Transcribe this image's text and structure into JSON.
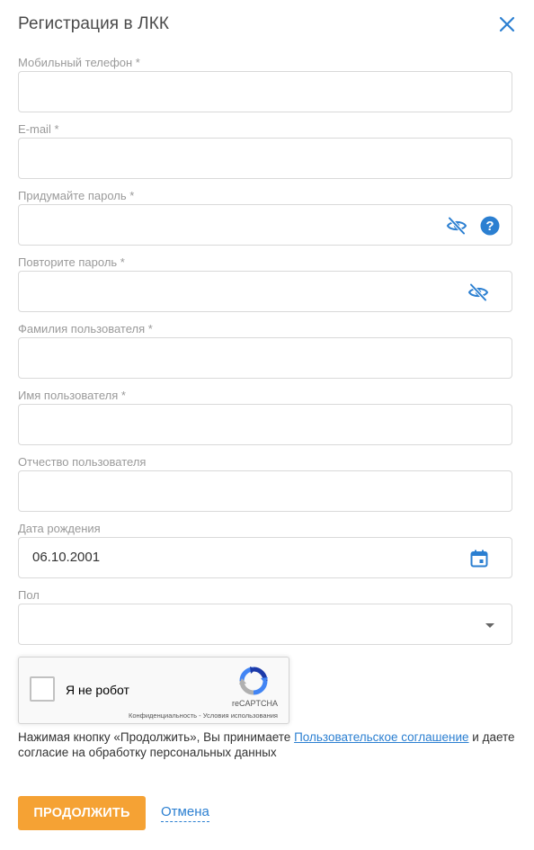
{
  "dialog": {
    "title": "Регистрация в ЛКК",
    "close_icon": "close-icon"
  },
  "fields": {
    "phone": {
      "label": "Мобильный телефон *",
      "value": ""
    },
    "email": {
      "label": "E-mail *",
      "value": ""
    },
    "password": {
      "label": "Придумайте пароль *",
      "value": ""
    },
    "password_repeat": {
      "label": "Повторите пароль *",
      "value": ""
    },
    "last_name": {
      "label": "Фамилия пользователя *",
      "value": ""
    },
    "first_name": {
      "label": "Имя пользователя *",
      "value": ""
    },
    "middle_name": {
      "label": "Отчество пользователя",
      "value": ""
    },
    "birth_date": {
      "label": "Дата рождения",
      "value": "06.10.2001"
    },
    "gender": {
      "label": "Пол",
      "value": ""
    }
  },
  "captcha": {
    "label": "Я не робот",
    "brand": "reCAPTCHA",
    "links": "Конфиденциальность - Условия использования"
  },
  "consent": {
    "text_before": "Нажимая кнопку «Продолжить», Вы принимаете ",
    "link": "Пользовательское соглашение",
    "text_after": " и даете согласие на обработку персональных данных"
  },
  "actions": {
    "continue_label": "ПРОДОЛЖИТЬ",
    "cancel_label": "Отмена"
  },
  "colors": {
    "accent": "#2b7fd1",
    "primary_button": "#f5a234"
  }
}
